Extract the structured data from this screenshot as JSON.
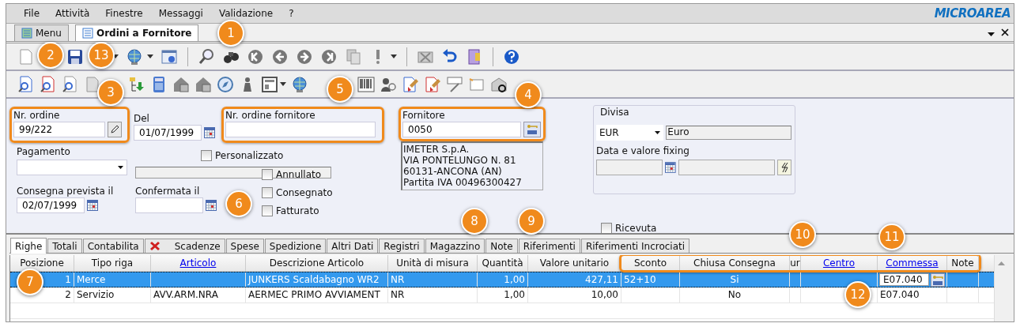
{
  "menu": [
    {
      "label": "File"
    },
    {
      "label": "Attività"
    },
    {
      "label": "Finestre"
    },
    {
      "label": "Messaggi"
    },
    {
      "label": "Validazione"
    },
    {
      "label": "?"
    }
  ],
  "logo": "MICROAREA",
  "document_tabs": [
    {
      "label": "Menu",
      "selected": false
    },
    {
      "label": "Ordini a Fornitore",
      "selected": true
    }
  ],
  "form": {
    "order_number": {
      "label": "Nr. ordine",
      "value": "99/222",
      "highlighted": true
    },
    "order_date": {
      "label": "Del",
      "value": "01/07/1999"
    },
    "supplier_order_number": {
      "label": "Nr. ordine fornitore",
      "highlighted": true
    },
    "supplier": {
      "label": "Fornitore",
      "value": "0050",
      "highlighted": true,
      "address": [
        "IMETER S.p.A.",
        "VIA PONTELUNGO N. 81",
        "60131-ANCONA (AN)",
        "Partita IVA 00496300427"
      ]
    },
    "currency": {
      "group_label": "Divisa",
      "code": "EUR",
      "name": "Euro",
      "fixing_label": "Data e valore fixing"
    },
    "payment": {
      "label": "Pagamento"
    },
    "custom": {
      "label": "Personalizzato",
      "checked": false
    },
    "expected_delivery": {
      "label": "Consegna prevista il",
      "value": "02/07/1999"
    },
    "confirmed": {
      "label": "Confermata il"
    },
    "flags": [
      {
        "label": "Annullato",
        "checked": false
      },
      {
        "label": "Consegnato",
        "checked": false
      },
      {
        "label": "Fatturato",
        "checked": false
      }
    ],
    "received": {
      "label": "Ricevuta",
      "checked": false
    }
  },
  "detail_tabs": [
    {
      "label": "Righe",
      "selected": true,
      "kind": "plain"
    },
    {
      "label": "Totali",
      "selected": false,
      "kind": "plain"
    },
    {
      "label": "Contabilita",
      "selected": false,
      "kind": "plain"
    },
    {
      "label": "Scadenze",
      "selected": false,
      "kind": "flagged"
    },
    {
      "label": "Spese",
      "selected": false,
      "kind": "plain"
    },
    {
      "label": "Spedizione",
      "selected": false,
      "kind": "plain"
    },
    {
      "label": "Altri Dati",
      "selected": false,
      "kind": "plain"
    },
    {
      "label": "Registri",
      "selected": false,
      "kind": "plain"
    },
    {
      "label": "Magazzino",
      "selected": false,
      "kind": "plain"
    },
    {
      "label": "Note",
      "selected": false,
      "kind": "plain"
    },
    {
      "label": "Riferimenti",
      "selected": false,
      "kind": "plain"
    },
    {
      "label": "Riferimenti Incrociati",
      "selected": false,
      "kind": "plain"
    }
  ],
  "table": {
    "columns": [
      {
        "label": "Posizione",
        "link": false,
        "highlighted": false
      },
      {
        "label": "Tipo riga",
        "link": false,
        "highlighted": false
      },
      {
        "label": "Articolo",
        "link": true,
        "highlighted": false
      },
      {
        "label": "Descrizione Articolo",
        "link": false,
        "highlighted": false
      },
      {
        "label": "Unità di misura",
        "link": false,
        "highlighted": false
      },
      {
        "label": "Quantità",
        "link": false,
        "highlighted": false
      },
      {
        "label": "Valore unitario",
        "link": false,
        "highlighted": false
      },
      {
        "label": "Sconto",
        "link": false,
        "highlighted": true
      },
      {
        "label": "Chiusa Consegna",
        "link": false,
        "highlighted": true
      },
      {
        "label": "ur",
        "link": false,
        "highlighted": true
      },
      {
        "label": "Centro",
        "link": true,
        "highlighted": true
      },
      {
        "label": "Commessa",
        "link": true,
        "highlighted": true
      },
      {
        "label": "Note",
        "link": false,
        "highlighted": true
      }
    ],
    "rows": [
      {
        "selected": true,
        "job_editor_open": true,
        "cells": [
          "1",
          "Merce",
          null,
          "JUNKERS Scaldabagno WR2",
          "NR",
          "1,00",
          "427,11",
          "52+10",
          "Si",
          null,
          null,
          "E07.040",
          null
        ]
      },
      {
        "selected": false,
        "job_editor_open": false,
        "cells": [
          "2",
          "Servizio",
          "AVV.ARM.NRA",
          "AERMEC PRIMO AVVIAMENT",
          "NR",
          "1,00",
          "10,00",
          null,
          "No",
          null,
          null,
          "E07.040",
          null
        ]
      }
    ]
  },
  "callouts": [
    {
      "number": "1"
    },
    {
      "number": "2"
    },
    {
      "number": "3"
    },
    {
      "number": "4"
    },
    {
      "number": "5"
    },
    {
      "number": "6"
    },
    {
      "number": "7"
    },
    {
      "number": "8"
    },
    {
      "number": "9"
    },
    {
      "number": "10"
    },
    {
      "number": "11"
    },
    {
      "number": "12"
    },
    {
      "number": "13"
    }
  ]
}
